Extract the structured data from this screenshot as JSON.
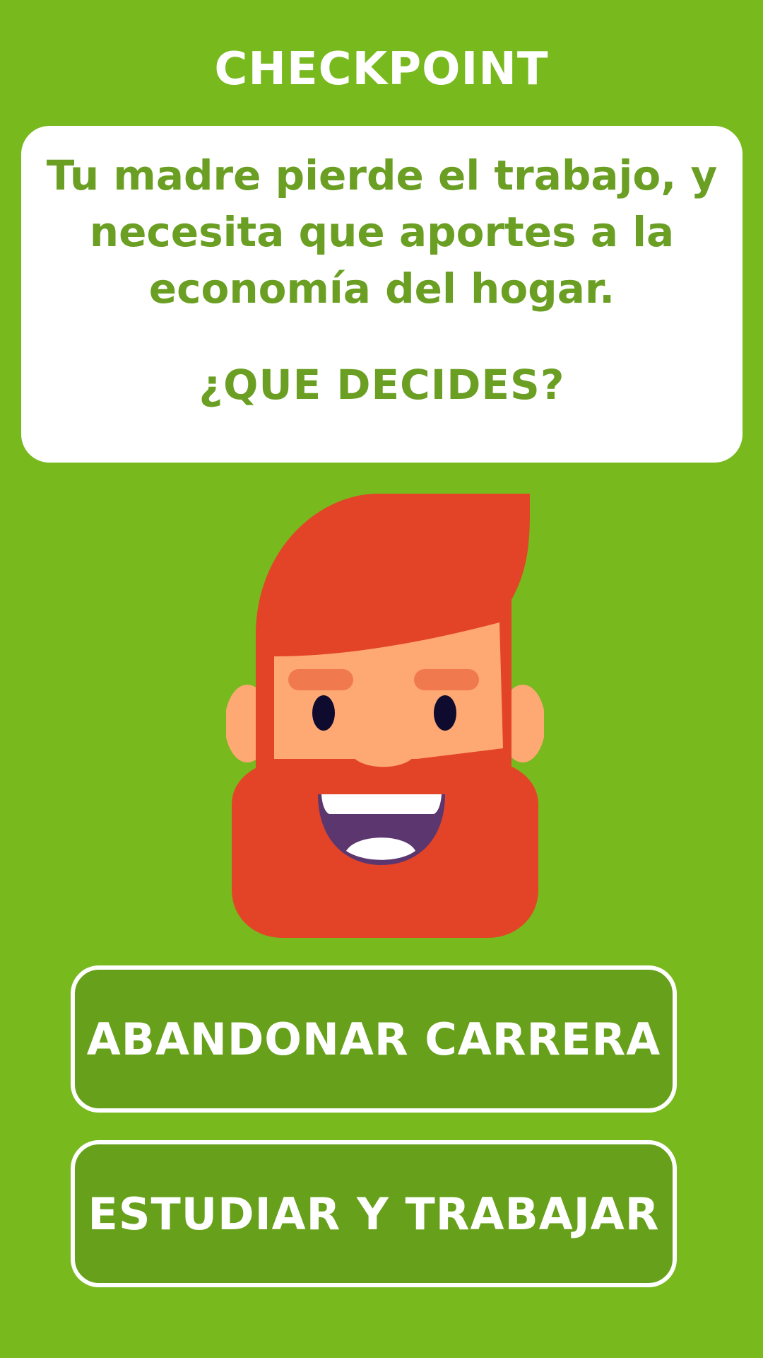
{
  "header": {
    "title": "CHECKPOINT"
  },
  "scenario": {
    "message": "Tu madre pierde el trabajo, y necesita que aportes a la economía del hogar.",
    "question": "¿QUE DECIDES?"
  },
  "avatar": {
    "icon": "bearded-man-avatar-icon",
    "colors": {
      "hair_beard": "#e34428",
      "skin": "#fea874",
      "mouth": "#5c376f",
      "eyes": "#0e0b2e"
    }
  },
  "choices": [
    {
      "label": "ABANDONAR CARRERA"
    },
    {
      "label": "ESTUDIAR Y TRABAJAR"
    }
  ],
  "colors": {
    "background": "#78b91e",
    "button": "#67a01b",
    "text_accent": "#6a9f23"
  }
}
